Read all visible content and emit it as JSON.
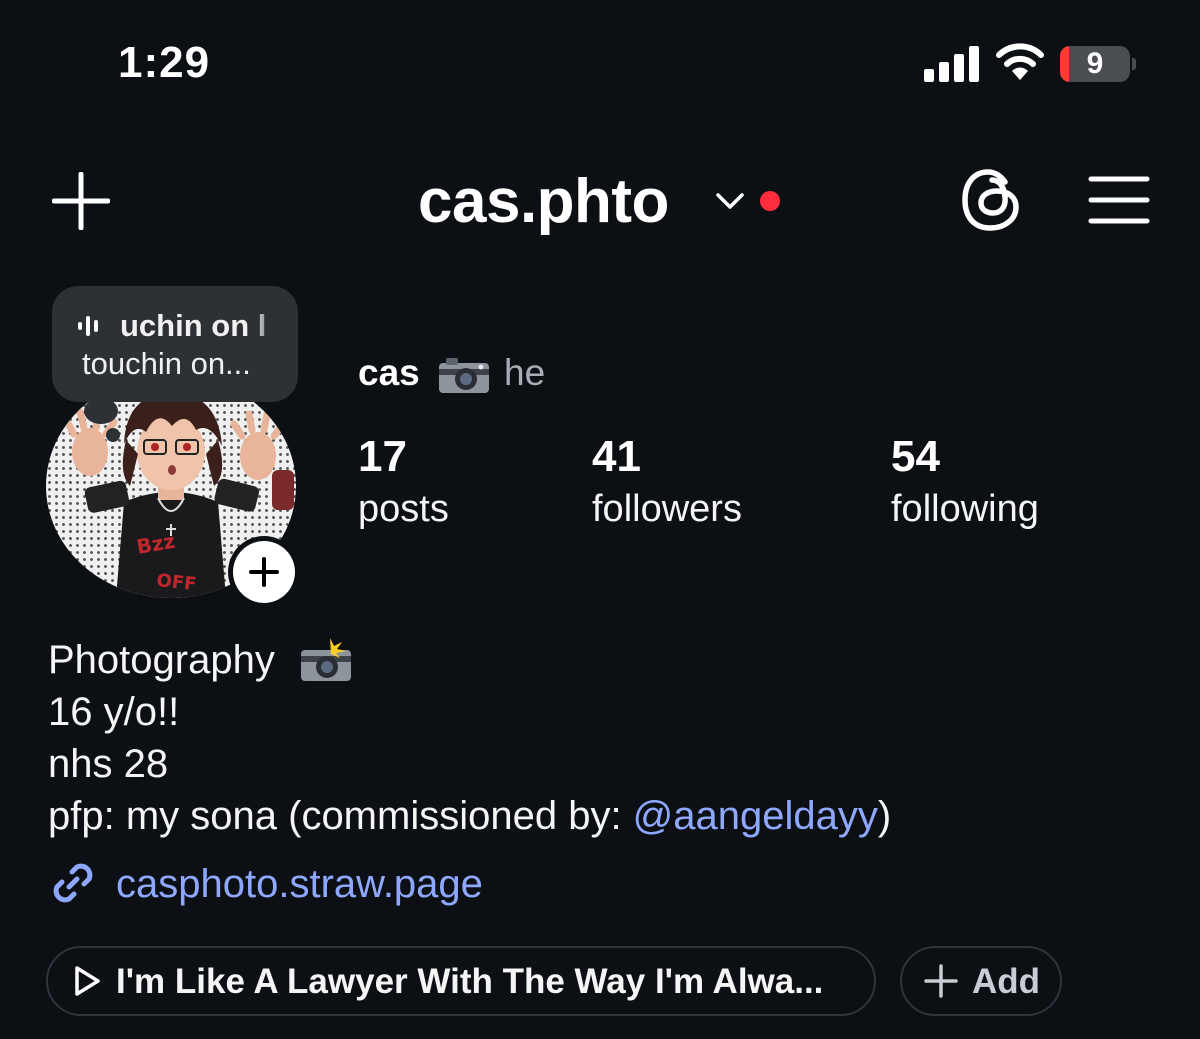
{
  "status_bar": {
    "time": "1:29",
    "battery_level": "9",
    "battery_color": "#ff3b30"
  },
  "header": {
    "username": "cas.phto",
    "left_icon": "plus-icon",
    "dropdown_icon": "chevron-down-icon",
    "notification_dot_color": "#ff2d3d",
    "right_icons": [
      "threads-icon",
      "menu-icon"
    ]
  },
  "note": {
    "line1": "uchin on l",
    "line2": "touchin on..."
  },
  "profile": {
    "display_name": "cas",
    "name_emoji": "camera-emoji",
    "pronouns": "he",
    "stats": [
      {
        "value": "17",
        "label": "posts"
      },
      {
        "value": "41",
        "label": "followers"
      },
      {
        "value": "54",
        "label": "following"
      }
    ]
  },
  "bio": {
    "line1": "Photography",
    "line1_emoji": "camera-flash-emoji",
    "line2": "16 y/o!!",
    "line3": "nhs 28",
    "line4_prefix": "pfp: my sona (commissioned by: ",
    "line4_mention": "@aangeldayy",
    "line4_suffix": ")",
    "link": "casphoto.straw.page",
    "accent_color": "#8fa8ff"
  },
  "pills": {
    "music": "I'm Like A Lawyer With The Way I'm Alwa...",
    "add": "Add"
  }
}
